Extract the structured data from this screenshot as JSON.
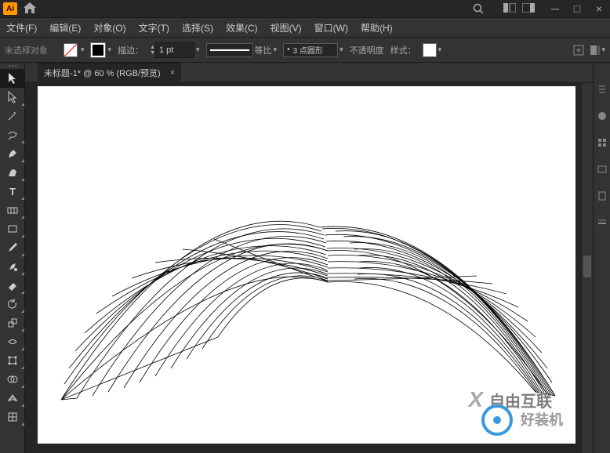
{
  "titleBar": {
    "appShort": "Ai"
  },
  "menu": {
    "file": "文件(F)",
    "edit": "编辑(E)",
    "object": "对象(O)",
    "type": "文字(T)",
    "select": "选择(S)",
    "effect": "效果(C)",
    "view": "视图(V)",
    "window": "窗口(W)",
    "help": "帮助(H)"
  },
  "options": {
    "noSelection": "未选择对象",
    "strokeLabel": "描边：",
    "strokeValue": "1 pt",
    "uniformLabel": "等比",
    "brushLabel": "3 点圆形",
    "brushBullet": "•",
    "opacityLabel": "不透明度",
    "styleLabel": "样式："
  },
  "document": {
    "tabTitle": "未标题-1* @ 60 % (RGB/预览)",
    "closeSymbol": "×"
  },
  "watermark": {
    "x": "X",
    "brand1": "自由互联",
    "brand2": "好装机"
  }
}
